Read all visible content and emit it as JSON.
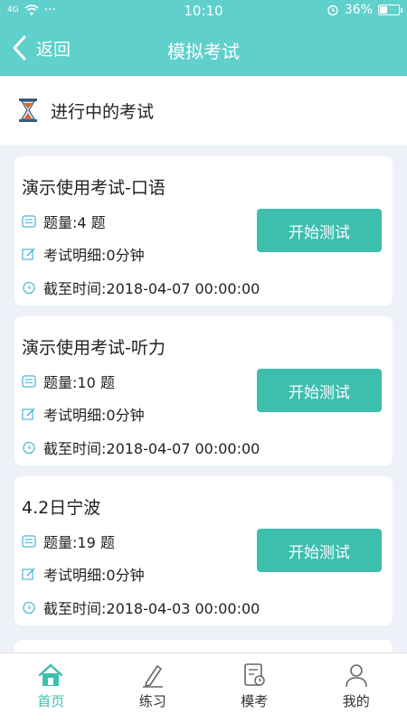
{
  "status_bar": {
    "network": "4G",
    "dots": "···",
    "time": "10:10",
    "battery": "36%"
  },
  "nav": {
    "back_label": "返回",
    "title": "模拟考试"
  },
  "section": {
    "title": "进行中的考试"
  },
  "exams": [
    {
      "title": "演示使用考试-口语",
      "count": "题量:4 题",
      "detail": "考试明细:0分钟",
      "deadline": "截至时间:2018-04-07 00:00:00",
      "button": "开始测试"
    },
    {
      "title": "演示使用考试-听力",
      "count": "题量:10 题",
      "detail": "考试明细:0分钟",
      "deadline": "截至时间:2018-04-07 00:00:00",
      "button": "开始测试"
    },
    {
      "title": "4.2日宁波",
      "count": "题量:19 题",
      "detail": "考试明细:0分钟",
      "deadline": "截至时间:2018-04-03 00:00:00",
      "button": "开始测试"
    }
  ],
  "tabs": [
    {
      "label": "首页",
      "icon": "home-icon",
      "active": true
    },
    {
      "label": "练习",
      "icon": "pencil-icon",
      "active": false
    },
    {
      "label": "模考",
      "icon": "exam-icon",
      "active": false
    },
    {
      "label": "我的",
      "icon": "user-icon",
      "active": false
    }
  ],
  "colors": {
    "header": "#5fd0cb",
    "button": "#3cbfad",
    "background": "#eef1f8"
  }
}
